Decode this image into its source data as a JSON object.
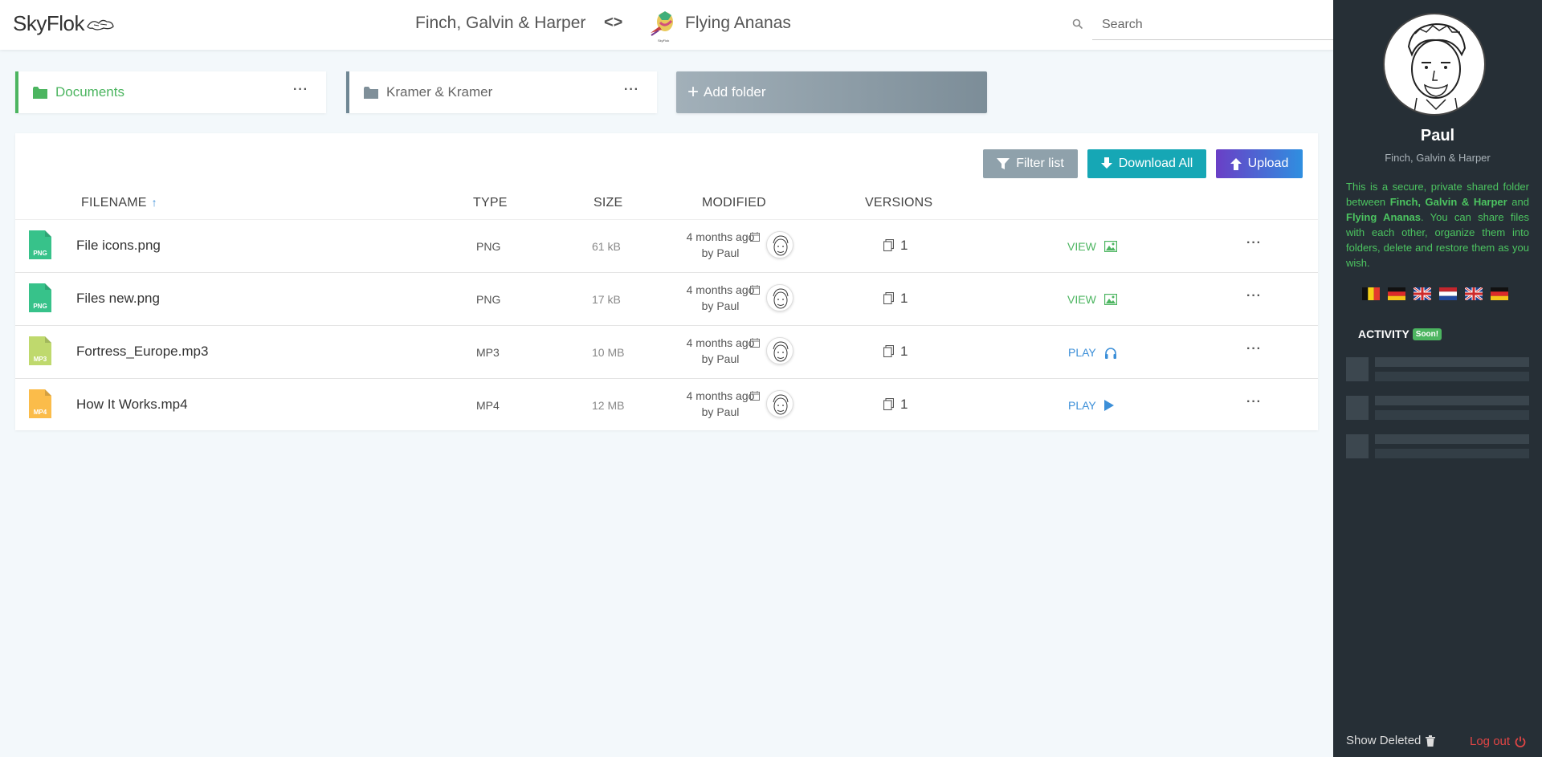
{
  "header": {
    "logo_text": "SkyFlok",
    "org_left": "Finch, Galvin & Harper",
    "swap_symbol": "<>",
    "org_right": "Flying Ananas",
    "search_placeholder": "Search"
  },
  "folders": [
    {
      "name": "Documents",
      "more": "···",
      "active": true
    },
    {
      "name": "Kramer & Kramer",
      "more": "···",
      "active": false
    }
  ],
  "add_folder_label": "Add folder",
  "toolbar": {
    "filter_label": "Filter list",
    "download_label": "Download All",
    "upload_label": "Upload"
  },
  "columns": {
    "filename": "FILENAME",
    "sort_arrow": "↑",
    "type": "TYPE",
    "size": "SIZE",
    "modified": "MODIFIED",
    "versions": "VERSIONS"
  },
  "files": [
    {
      "name": "File icons.png",
      "icon_label": "PNG",
      "icon_color": "#37c28a",
      "type": "PNG",
      "size": "61 kB",
      "modified": "4 months ago",
      "by": "by Paul",
      "versions": "1",
      "action": "VIEW",
      "action_kind": "view",
      "more": "···"
    },
    {
      "name": "Files new.png",
      "icon_label": "PNG",
      "icon_color": "#37c28a",
      "type": "PNG",
      "size": "17 kB",
      "modified": "4 months ago",
      "by": "by Paul",
      "versions": "1",
      "action": "VIEW",
      "action_kind": "view",
      "more": "···"
    },
    {
      "name": "Fortress_Europe.mp3",
      "icon_label": "MP3",
      "icon_color": "#bfd96d",
      "type": "MP3",
      "size": "10 MB",
      "modified": "4 months ago",
      "by": "by Paul",
      "versions": "1",
      "action": "PLAY",
      "action_kind": "audio",
      "more": "···"
    },
    {
      "name": "How It Works.mp4",
      "icon_label": "MP4",
      "icon_color": "#fbbc4a",
      "type": "MP4",
      "size": "12 MB",
      "modified": "4 months ago",
      "by": "by Paul",
      "versions": "1",
      "action": "PLAY",
      "action_kind": "video",
      "more": "···"
    }
  ],
  "sidebar": {
    "user_name": "Paul",
    "user_org": "Finch, Galvin & Harper",
    "info_1": "This is a secure, private shared folder between ",
    "info_org_a": "Finch, Galvin & Harper",
    "info_and": " and ",
    "info_org_b": "Flying Ananas",
    "info_2": ". You can share files with each other, organize them into folders, delete and restore them as you wish.",
    "activity_label": "ACTIVITY",
    "soon_badge": "Soon!",
    "show_deleted": "Show Deleted",
    "logout": "Log out"
  },
  "colors": {
    "accent_green": "#4cb560",
    "accent_blue": "#3c8fd8",
    "sidebar_bg": "#262f36"
  }
}
